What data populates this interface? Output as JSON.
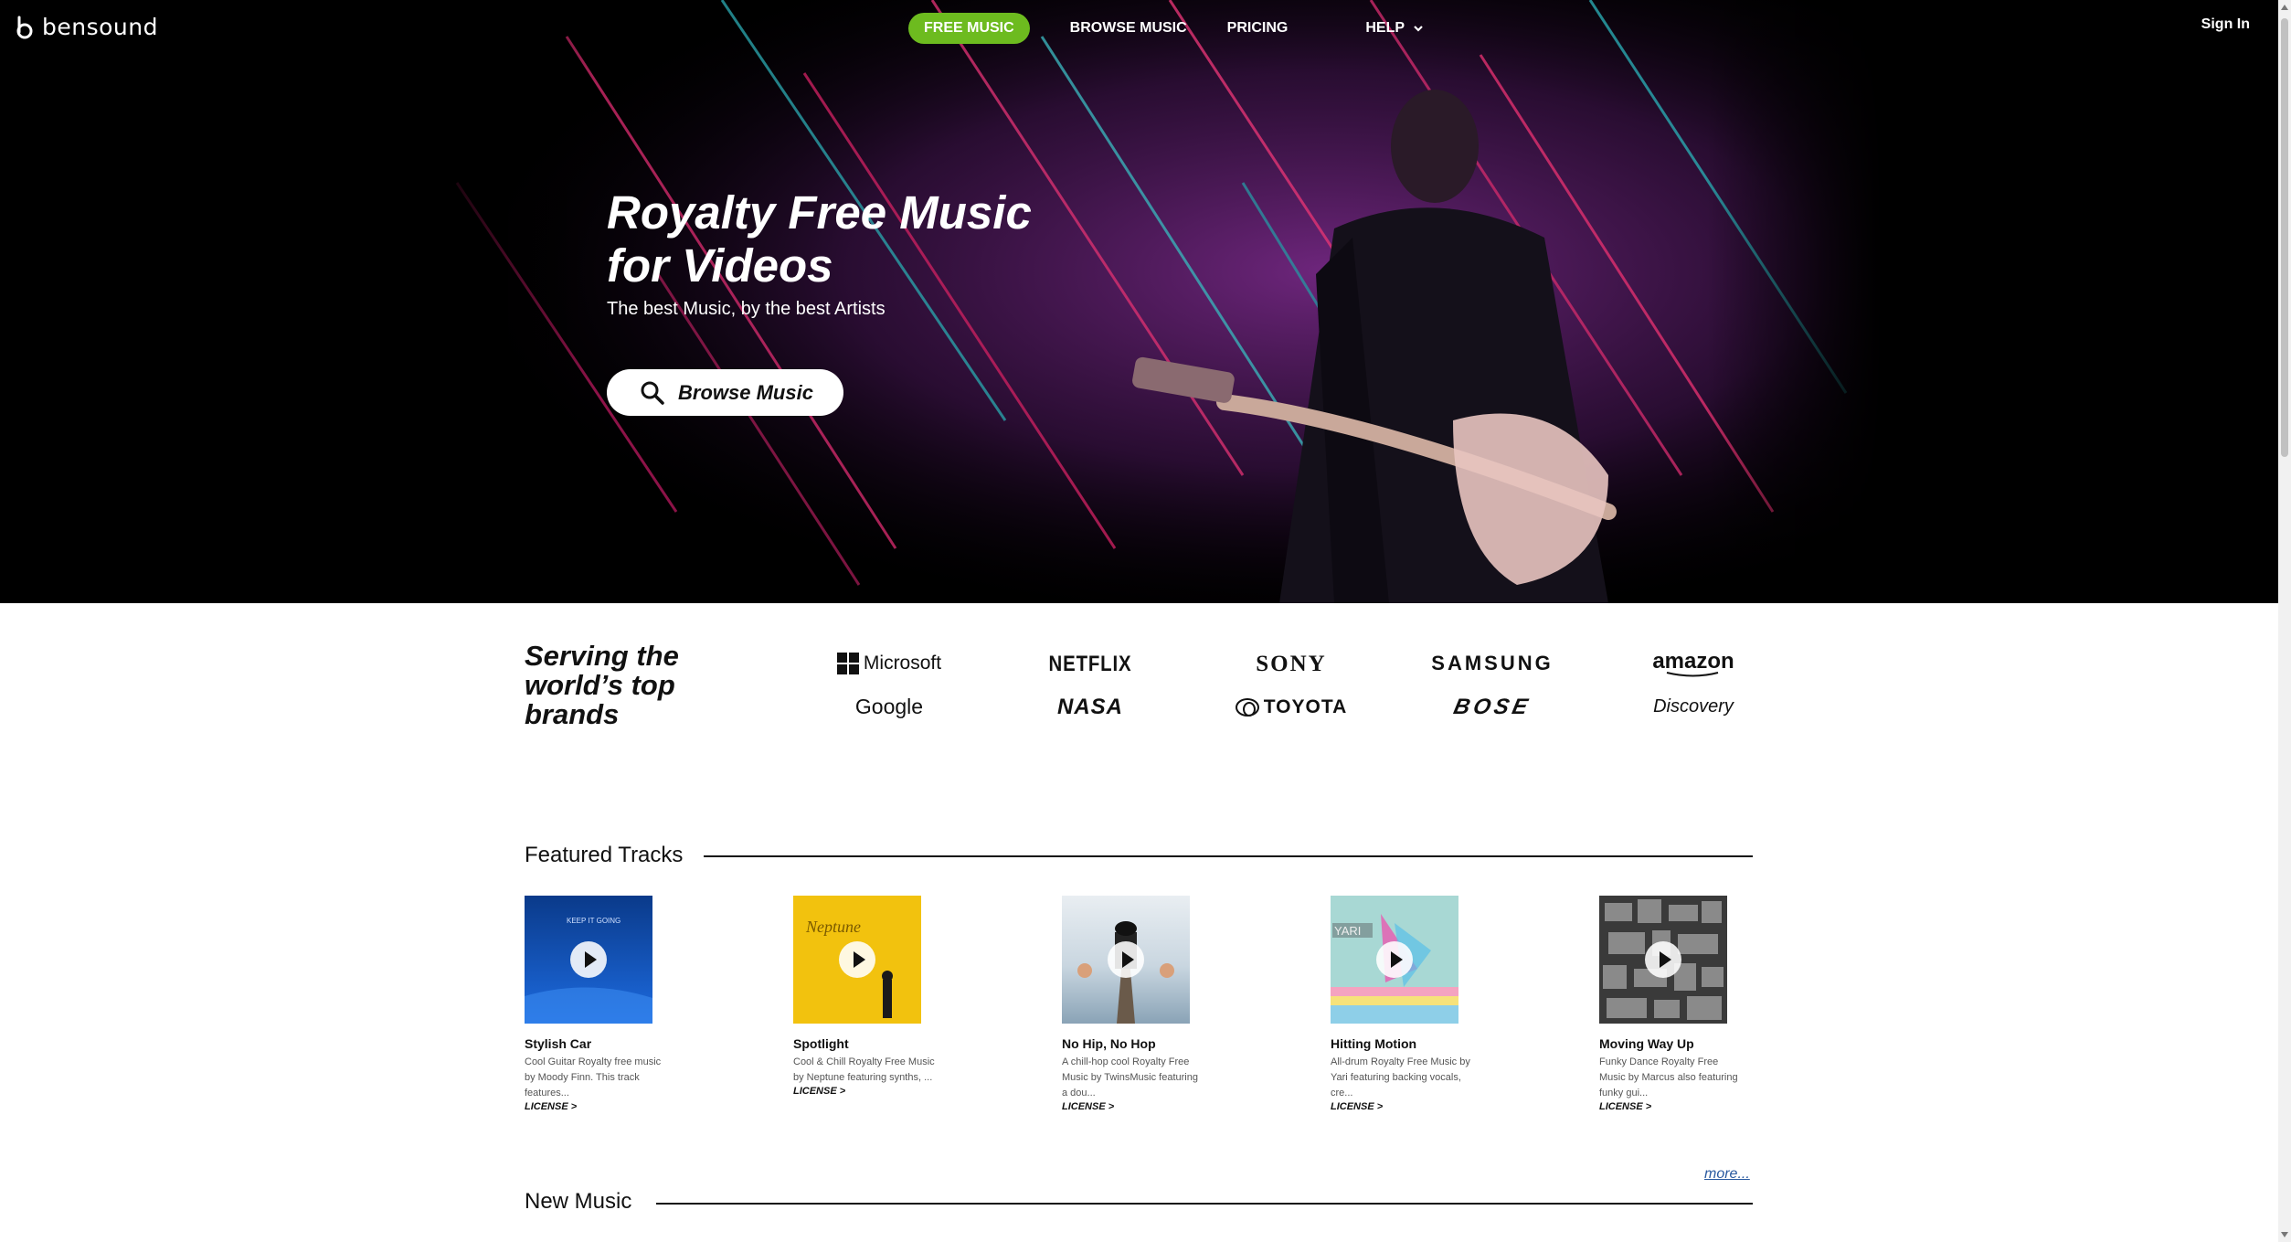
{
  "header": {
    "logo_text": "bensound",
    "nav": {
      "free_music": "FREE MUSIC",
      "browse_music": "BROWSE MUSIC",
      "pricing": "PRICING",
      "help": "HELP"
    },
    "sign_in": "Sign In"
  },
  "hero": {
    "title_line1": "Royalty Free Music",
    "title_line2": "for Videos",
    "subtitle": "The best Music, by the best Artists",
    "button_label": "Browse Music"
  },
  "brands": {
    "heading_line1": "Serving the",
    "heading_line2": "world’s top",
    "heading_line3": "brands",
    "row1": [
      "Microsoft",
      "NETFLIX",
      "SONY",
      "SAMSUNG",
      "amazon"
    ],
    "row2": [
      "Google",
      "NASA",
      "TOYOTA",
      "BOSE",
      "Discovery"
    ]
  },
  "featured": {
    "title": "Featured Tracks",
    "tracks": [
      {
        "title": "Stylish Car",
        "desc_l1": "Cool Guitar Royalty free music",
        "desc_l2": "by Moody Finn. This track",
        "desc_l3": "features...",
        "license": "LICENSE >"
      },
      {
        "title": "Spotlight",
        "desc_l1": "Cool & Chill Royalty Free Music",
        "desc_l2": "by Neptune featuring synths, ...",
        "desc_l3": "",
        "license": "LICENSE >"
      },
      {
        "title": "No Hip, No Hop",
        "desc_l1": "A chill-hop cool Royalty Free",
        "desc_l2": "Music by TwinsMusic featuring",
        "desc_l3": "a dou...",
        "license": "LICENSE >"
      },
      {
        "title": "Hitting Motion",
        "desc_l1": "All-drum Royalty Free Music by",
        "desc_l2": "Yari featuring backing vocals,",
        "desc_l3": "cre...",
        "license": "LICENSE >"
      },
      {
        "title": "Moving Way Up",
        "desc_l1": "Funky Dance Royalty Free",
        "desc_l2": "Music by Marcus also featuring",
        "desc_l3": "funky gui...",
        "license": "LICENSE >"
      }
    ],
    "cover_texts": [
      "KEEP IT GOING",
      "Neptune",
      "",
      "YARI",
      ""
    ],
    "more": "more..."
  },
  "new_music": {
    "title": "New Music"
  },
  "colors": {
    "accent_green": "#6dbb1f",
    "hero_bg": "#000000"
  }
}
